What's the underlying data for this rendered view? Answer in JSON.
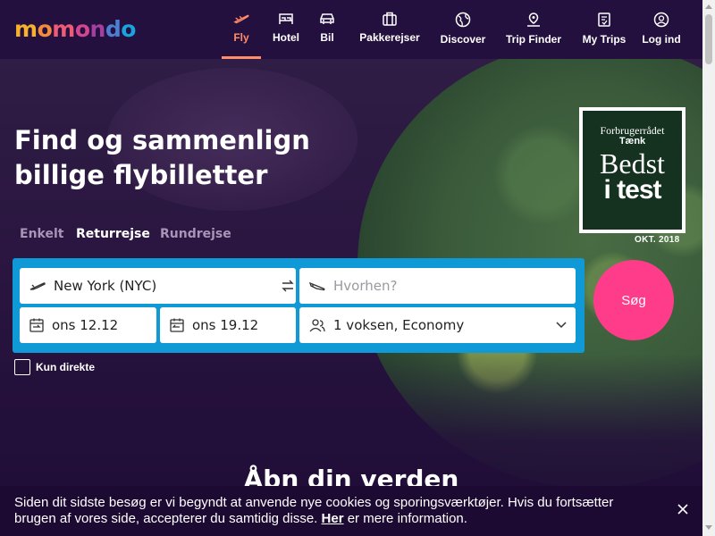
{
  "brand": {
    "logo_letters": [
      "m",
      "o",
      "m",
      "o",
      "n",
      "d",
      "o"
    ],
    "logo_colors": [
      "#f7b12c",
      "#f48a3c",
      "#ef5a76",
      "#d2458f",
      "#a33f9f",
      "#4c7fd1",
      "#1aa3dc"
    ]
  },
  "nav": {
    "items": [
      {
        "label": "Fly",
        "icon": "plane-icon",
        "active": true
      },
      {
        "label": "Hotel",
        "icon": "bed-icon"
      },
      {
        "label": "Bil",
        "icon": "car-icon"
      },
      {
        "label": "Pakkerejser",
        "icon": "suitcase-icon"
      },
      {
        "label": "Discover",
        "icon": "globe-icon"
      },
      {
        "label": "Trip Finder",
        "icon": "map-pin-icon"
      },
      {
        "label": "My Trips",
        "icon": "itinerary-icon"
      },
      {
        "label": "Log ind",
        "icon": "user-icon"
      }
    ]
  },
  "hero": {
    "title_line1": "Find og sammenlign",
    "title_line2": "billige flybilletter"
  },
  "badge": {
    "line1": "Forbrugerrådet",
    "line2": "Tænk",
    "line3": "Bedst",
    "line4": "i test",
    "date": "OKT. 2018"
  },
  "trip_types": [
    {
      "label": "Enkelt"
    },
    {
      "label": "Returrejse",
      "active": true
    },
    {
      "label": "Rundrejse"
    }
  ],
  "search": {
    "origin": "New York (NYC)",
    "destination_placeholder": "Hvorhen?",
    "depart_date": "ons 12.12",
    "return_date": "ons 19.12",
    "travelers": "1 voksen, Economy",
    "button_label": "Søg",
    "direct_only_label": "Kun direkte",
    "direct_only_checked": false
  },
  "section": {
    "heading": "Åbn din verden"
  },
  "cookie_banner": {
    "text_before": "Siden dit sidste besøg er vi begyndt at anvende nye cookies og sporingsværktøjer. Hvis du fortsætter brugen af vores side, accepterer du samtidig disse.",
    "link_text": "Her",
    "text_after": "er mere information."
  },
  "colors": {
    "header_bg": "#24103e",
    "active_nav": "#ff8c6a",
    "search_panel": "#0f9ad7",
    "search_button": "#ff3c8a"
  }
}
